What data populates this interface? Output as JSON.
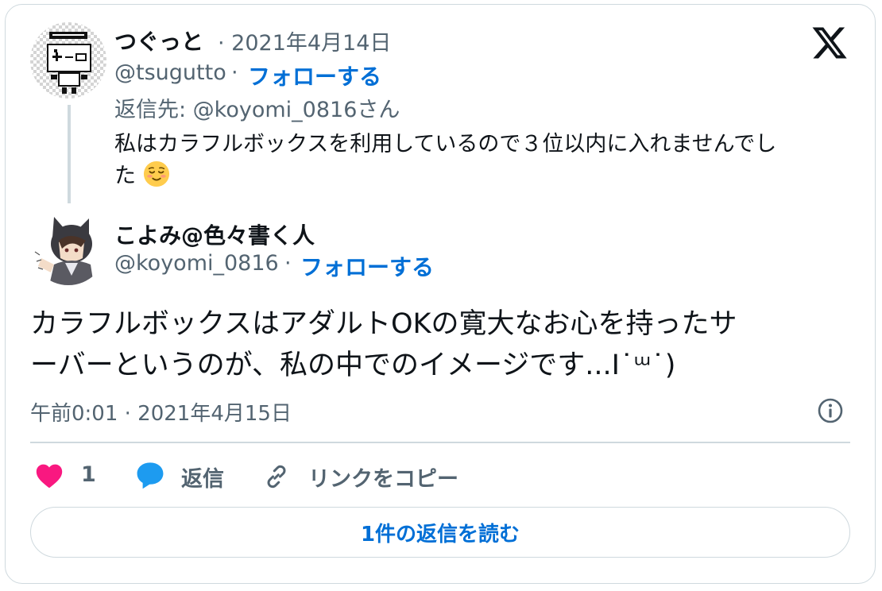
{
  "reply_tweet": {
    "author_name": "つぐっと",
    "date": "· 2021年4月14日",
    "handle": "@tsugutto",
    "separator": "·",
    "follow_label": "フォローする",
    "reply_to": "返信先: @koyomi_0816さん",
    "text_line1": "私はカラフルボックスを利用しているので３位以内に入れませんでし",
    "text_line2": "た",
    "emoji": "relieved-face-emoji"
  },
  "main_tweet": {
    "author_name": "こよみ@色々書く人",
    "handle": "@koyomi_0816",
    "separator": "·",
    "follow_label": "フォローする",
    "text_line1": "カラフルボックスはアダルトOKの寛大なお心を持ったサ",
    "text_line2": "ーバーというのが、私の中でのイメージです...І˙ᵚ˙)",
    "timestamp": "午前0:01 · 2021年4月15日"
  },
  "actions": {
    "like_count": "1",
    "reply_label": "返信",
    "copy_link_label": "リンクをコピー"
  },
  "read_replies_label": "1件の返信を読む",
  "icons": [
    "x-logo-icon",
    "heart-icon",
    "reply-bubble-icon",
    "link-icon",
    "info-icon"
  ],
  "colors": {
    "follow_blue": "#006fd6",
    "heart_pink": "#f91880",
    "reply_blue": "#1d9bf0",
    "muted_gray": "#536471",
    "border": "#cfd9de"
  }
}
